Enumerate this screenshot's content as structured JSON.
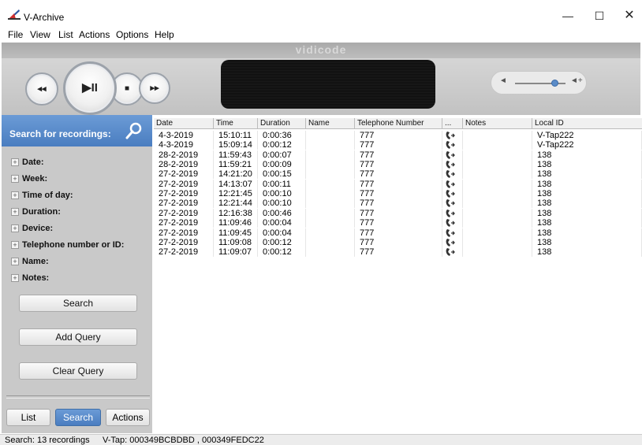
{
  "window": {
    "title": "V-Archive",
    "minimize": "—",
    "maximize": "☐",
    "close": "✕"
  },
  "menu": [
    "File",
    "View",
    "List",
    "Actions",
    "Options",
    "Help"
  ],
  "brand": "vidicode",
  "player": {
    "rewind": "◂◂",
    "play_pause": "▶II",
    "stop": "■",
    "forward": "▸▸"
  },
  "volume": {
    "level_fraction": 0.78,
    "low_icon": "speaker-low-icon",
    "high_icon": "speaker-high-icon"
  },
  "search_panel": {
    "title": "Search for recordings:",
    "criteria": [
      "Date:",
      "Week:",
      "Time of day:",
      "Duration:",
      "Device:",
      "Telephone number or ID:",
      "Name:",
      "Notes:"
    ],
    "search_button": "Search",
    "add_query_button": "Add Query",
    "clear_query_button": "Clear Query"
  },
  "bottom_tabs": {
    "list": "List",
    "search": "Search",
    "actions": "Actions"
  },
  "table": {
    "columns": [
      "Date",
      "Time",
      "Duration",
      "Name",
      "Telephone Number",
      "...",
      "Notes",
      "Local ID"
    ],
    "rows": [
      {
        "date": "4-3-2019",
        "time": "15:10:11",
        "duration": "0:00:36",
        "name": "",
        "phone": "777",
        "notes": "",
        "local_id": "V-Tap222"
      },
      {
        "date": "4-3-2019",
        "time": "15:09:14",
        "duration": "0:00:12",
        "name": "",
        "phone": "777",
        "notes": "",
        "local_id": "V-Tap222"
      },
      {
        "date": "28-2-2019",
        "time": "11:59:43",
        "duration": "0:00:07",
        "name": "",
        "phone": "777",
        "notes": "",
        "local_id": "138"
      },
      {
        "date": "28-2-2019",
        "time": "11:59:21",
        "duration": "0:00:09",
        "name": "",
        "phone": "777",
        "notes": "",
        "local_id": "138"
      },
      {
        "date": "27-2-2019",
        "time": "14:21:20",
        "duration": "0:00:15",
        "name": "",
        "phone": "777",
        "notes": "",
        "local_id": "138"
      },
      {
        "date": "27-2-2019",
        "time": "14:13:07",
        "duration": "0:00:11",
        "name": "",
        "phone": "777",
        "notes": "",
        "local_id": "138"
      },
      {
        "date": "27-2-2019",
        "time": "12:21:45",
        "duration": "0:00:10",
        "name": "",
        "phone": "777",
        "notes": "",
        "local_id": "138"
      },
      {
        "date": "27-2-2019",
        "time": "12:21:44",
        "duration": "0:00:10",
        "name": "",
        "phone": "777",
        "notes": "",
        "local_id": "138"
      },
      {
        "date": "27-2-2019",
        "time": "12:16:38",
        "duration": "0:00:46",
        "name": "",
        "phone": "777",
        "notes": "",
        "local_id": "138"
      },
      {
        "date": "27-2-2019",
        "time": "11:09:46",
        "duration": "0:00:04",
        "name": "",
        "phone": "777",
        "notes": "",
        "local_id": "138"
      },
      {
        "date": "27-2-2019",
        "time": "11:09:45",
        "duration": "0:00:04",
        "name": "",
        "phone": "777",
        "notes": "",
        "local_id": "138"
      },
      {
        "date": "27-2-2019",
        "time": "11:09:08",
        "duration": "0:00:12",
        "name": "",
        "phone": "777",
        "notes": "",
        "local_id": "138"
      },
      {
        "date": "27-2-2019",
        "time": "11:09:07",
        "duration": "0:00:12",
        "name": "",
        "phone": "777",
        "notes": "",
        "local_id": "138"
      }
    ]
  },
  "status": {
    "count": "Search: 13 recordings",
    "vtap": "V-Tap: 000349BCBDBD , 000349FEDC22"
  },
  "colors": {
    "accent": "#5a8cd0",
    "panel": "#c9c9c9",
    "display": "#141414"
  }
}
